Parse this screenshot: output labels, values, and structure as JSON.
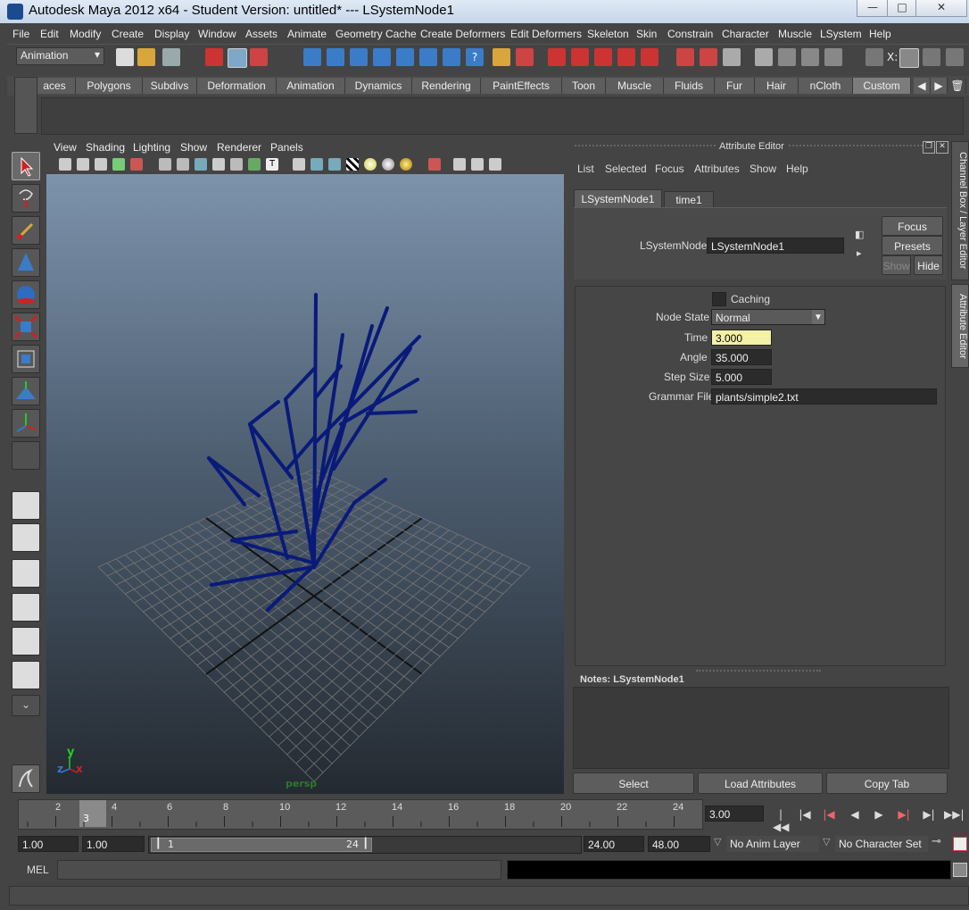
{
  "window": {
    "title": "Autodesk Maya 2012 x64 - Student Version: untitled*   ---   LSystemNode1",
    "min_icon": "minimize-icon",
    "max_icon": "maximize-icon",
    "close_icon": "close-icon"
  },
  "menu": [
    "File",
    "Edit",
    "Modify",
    "Create",
    "Display",
    "Window",
    "Assets",
    "Animate",
    "Geometry Cache",
    "Create Deformers",
    "Edit Deformers",
    "Skeleton",
    "Skin",
    "Constrain",
    "Character",
    "Muscle",
    "LSystem",
    "Help"
  ],
  "status": {
    "mode": "Animation",
    "xlabel": "X:"
  },
  "shelf": {
    "tabs": [
      "aces",
      "Polygons",
      "Subdivs",
      "Deformation",
      "Animation",
      "Dynamics",
      "Rendering",
      "PaintEffects",
      "Toon",
      "Muscle",
      "Fluids",
      "Fur",
      "Hair",
      "nCloth",
      "Custom"
    ],
    "active": "Custom"
  },
  "viewport": {
    "menu": [
      "View",
      "Shading",
      "Lighting",
      "Show",
      "Renderer",
      "Panels"
    ],
    "camera": "persp",
    "axis_y": "y",
    "axis_z": "z",
    "axis_x": "x"
  },
  "attr_editor": {
    "title": "Attribute Editor",
    "menu": [
      "List",
      "Selected",
      "Focus",
      "Attributes",
      "Show",
      "Help"
    ],
    "tabs": [
      "LSystemNode1",
      "time1"
    ],
    "node_label": "LSystemNode:",
    "node_value": "LSystemNode1",
    "focus_btn": "Focus",
    "presets_btn": "Presets",
    "show_btn": "Show",
    "hide_btn": "Hide",
    "caching_label": "Caching",
    "node_state_label": "Node State",
    "node_state_value": "Normal",
    "time_label": "Time",
    "time_value": "3.000",
    "angle_label": "Angle",
    "angle_value": "35.000",
    "step_label": "Step Size",
    "step_value": "5.000",
    "grammar_label": "Grammar File",
    "grammar_value": "plants/simple2.txt",
    "notes_label": "Notes:  LSystemNode1",
    "select_btn": "Select",
    "load_btn": "Load Attributes",
    "copy_btn": "Copy Tab",
    "side_tab1": "Channel Box / Layer Editor",
    "side_tab2": "Attribute Editor"
  },
  "timeline": {
    "ticks": [
      "2",
      "4",
      "6",
      "8",
      "10",
      "12",
      "14",
      "16",
      "18",
      "20",
      "22",
      "24"
    ],
    "current": "3",
    "current_field": "3.00"
  },
  "range": {
    "start": "1.00",
    "start2": "1.00",
    "slider_start": "1",
    "slider_end": "24",
    "end": "24.00",
    "end2": "48.00",
    "anim_layer": "No Anim Layer",
    "char_set": "No Character Set"
  },
  "mel": {
    "label": "MEL"
  }
}
